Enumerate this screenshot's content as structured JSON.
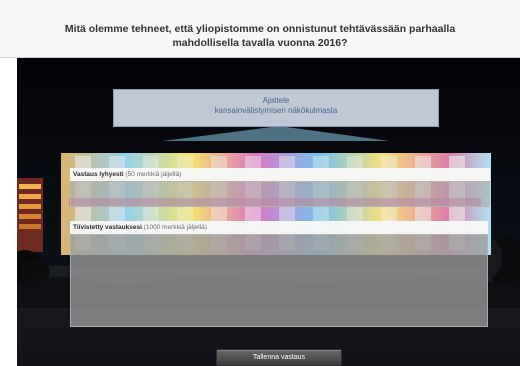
{
  "header": {
    "title_line_1": "Mitä olemme tehneet, että yliopistomme on onnistunut tehtävässään parhaalla",
    "title_line_2": "mahdollisella tavalla vuonna 2016?"
  },
  "prompt_card": {
    "title": "Ajattele",
    "subtitle": "kansainvälistymisen näkökulmasta"
  },
  "short_answer": {
    "label": "Vastaus lyhyesti",
    "hint": "(50 merkkiä jäljellä)"
  },
  "long_answer": {
    "label": "Tiivistetty vastauksesi",
    "hint": "(1000 merkkiä jäljellä)"
  },
  "submit_button": {
    "label": "Tallenna vastaus"
  }
}
